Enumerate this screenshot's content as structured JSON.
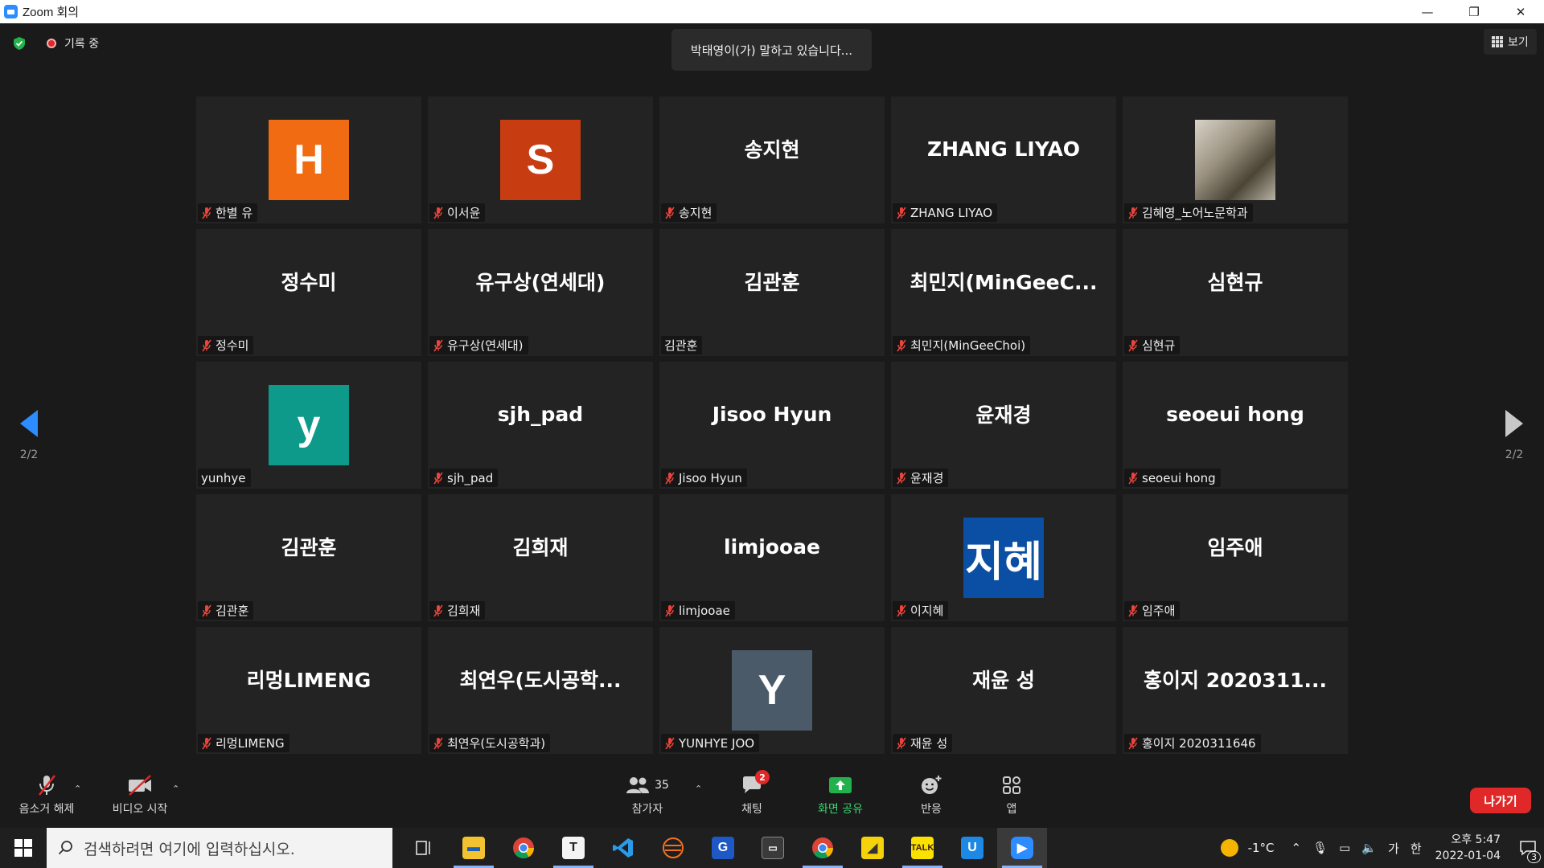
{
  "window": {
    "title": "Zoom 회의"
  },
  "window_controls": {
    "minimize": "—",
    "restore": "❐",
    "close": "✕"
  },
  "recording": {
    "label": "기록 중"
  },
  "speaking_banner": "박태영이(가) 말하고 있습니다...",
  "view_button": {
    "label": "보기"
  },
  "pager": {
    "left_text": "2/2",
    "right_text": "2/2"
  },
  "colors": {
    "accent": "#2d8cff",
    "leave": "#e02828",
    "share": "#39d36f"
  },
  "participants": [
    {
      "display": "H",
      "name": "한별 유",
      "avatar": true,
      "avatar_color": "#f06b12",
      "muted": true
    },
    {
      "display": "S",
      "name": "이서윤",
      "avatar": true,
      "avatar_color": "#c83c12",
      "muted": true
    },
    {
      "display": "송지현",
      "name": "송지현",
      "avatar": false,
      "muted": true
    },
    {
      "display": "ZHANG LIYAO",
      "name": "ZHANG LIYAO",
      "avatar": false,
      "muted": true
    },
    {
      "display": "",
      "name": "김혜영_노어노문학과",
      "avatar": true,
      "photo": true,
      "muted": true
    },
    {
      "display": "정수미",
      "name": "정수미",
      "avatar": false,
      "muted": true
    },
    {
      "display": "유구상(연세대)",
      "name": "유구상(연세대)",
      "avatar": false,
      "muted": true
    },
    {
      "display": "김관훈",
      "name": "김관훈",
      "avatar": false,
      "muted": false
    },
    {
      "display": "최민지(MinGeeC...",
      "name": "최민지(MinGeeChoi)",
      "avatar": false,
      "muted": true
    },
    {
      "display": "심현규",
      "name": "심현규",
      "avatar": false,
      "muted": true
    },
    {
      "display": "y",
      "name": "yunhye",
      "avatar": true,
      "avatar_color": "#0e9a8a",
      "muted": false
    },
    {
      "display": "sjh_pad",
      "name": "sjh_pad",
      "avatar": false,
      "muted": true
    },
    {
      "display": "Jisoo Hyun",
      "name": "Jisoo Hyun",
      "avatar": false,
      "muted": true
    },
    {
      "display": "윤재경",
      "name": "윤재경",
      "avatar": false,
      "muted": true
    },
    {
      "display": "seoeui hong",
      "name": "seoeui hong",
      "avatar": false,
      "muted": true
    },
    {
      "display": "김관훈",
      "name": "김관훈",
      "avatar": false,
      "muted": true
    },
    {
      "display": "김희재",
      "name": "김희재",
      "avatar": false,
      "muted": true
    },
    {
      "display": "limjooae",
      "name": "limjooae",
      "avatar": false,
      "muted": true
    },
    {
      "display": "지혜",
      "name": "이지혜",
      "avatar": true,
      "avatar_color": "#0a4fa3",
      "muted": true
    },
    {
      "display": "임주애",
      "name": "임주애",
      "avatar": false,
      "muted": true
    },
    {
      "display": "리멍LIMENG",
      "name": "리멍LIMENG",
      "avatar": false,
      "muted": true
    },
    {
      "display": "최연우(도시공학...",
      "name": "최연우(도시공학과)",
      "avatar": false,
      "muted": true
    },
    {
      "display": "Y",
      "name": "YUNHYE JOO",
      "avatar": true,
      "avatar_color": "#4a5a68",
      "muted": true
    },
    {
      "display": "재윤 성",
      "name": "재윤 성",
      "avatar": false,
      "muted": true
    },
    {
      "display": "홍이지 2020311...",
      "name": "홍이지 2020311646",
      "avatar": false,
      "muted": true
    }
  ],
  "toolbar": {
    "unmute": "음소거 해제",
    "start_video": "비디오 시작",
    "participants": "참가자",
    "participants_count": "35",
    "chat": "채팅",
    "chat_badge": "2",
    "share_screen": "화면 공유",
    "reactions": "반응",
    "apps": "앱",
    "leave": "나가기"
  },
  "taskbar": {
    "search_placeholder": "검색하려면 여기에 입력하십시오.",
    "temperature": "-1°C",
    "ime_mode": "가",
    "ime_lang": "한",
    "time": "오후 5:47",
    "date": "2022-01-04",
    "notification_count": "3"
  }
}
